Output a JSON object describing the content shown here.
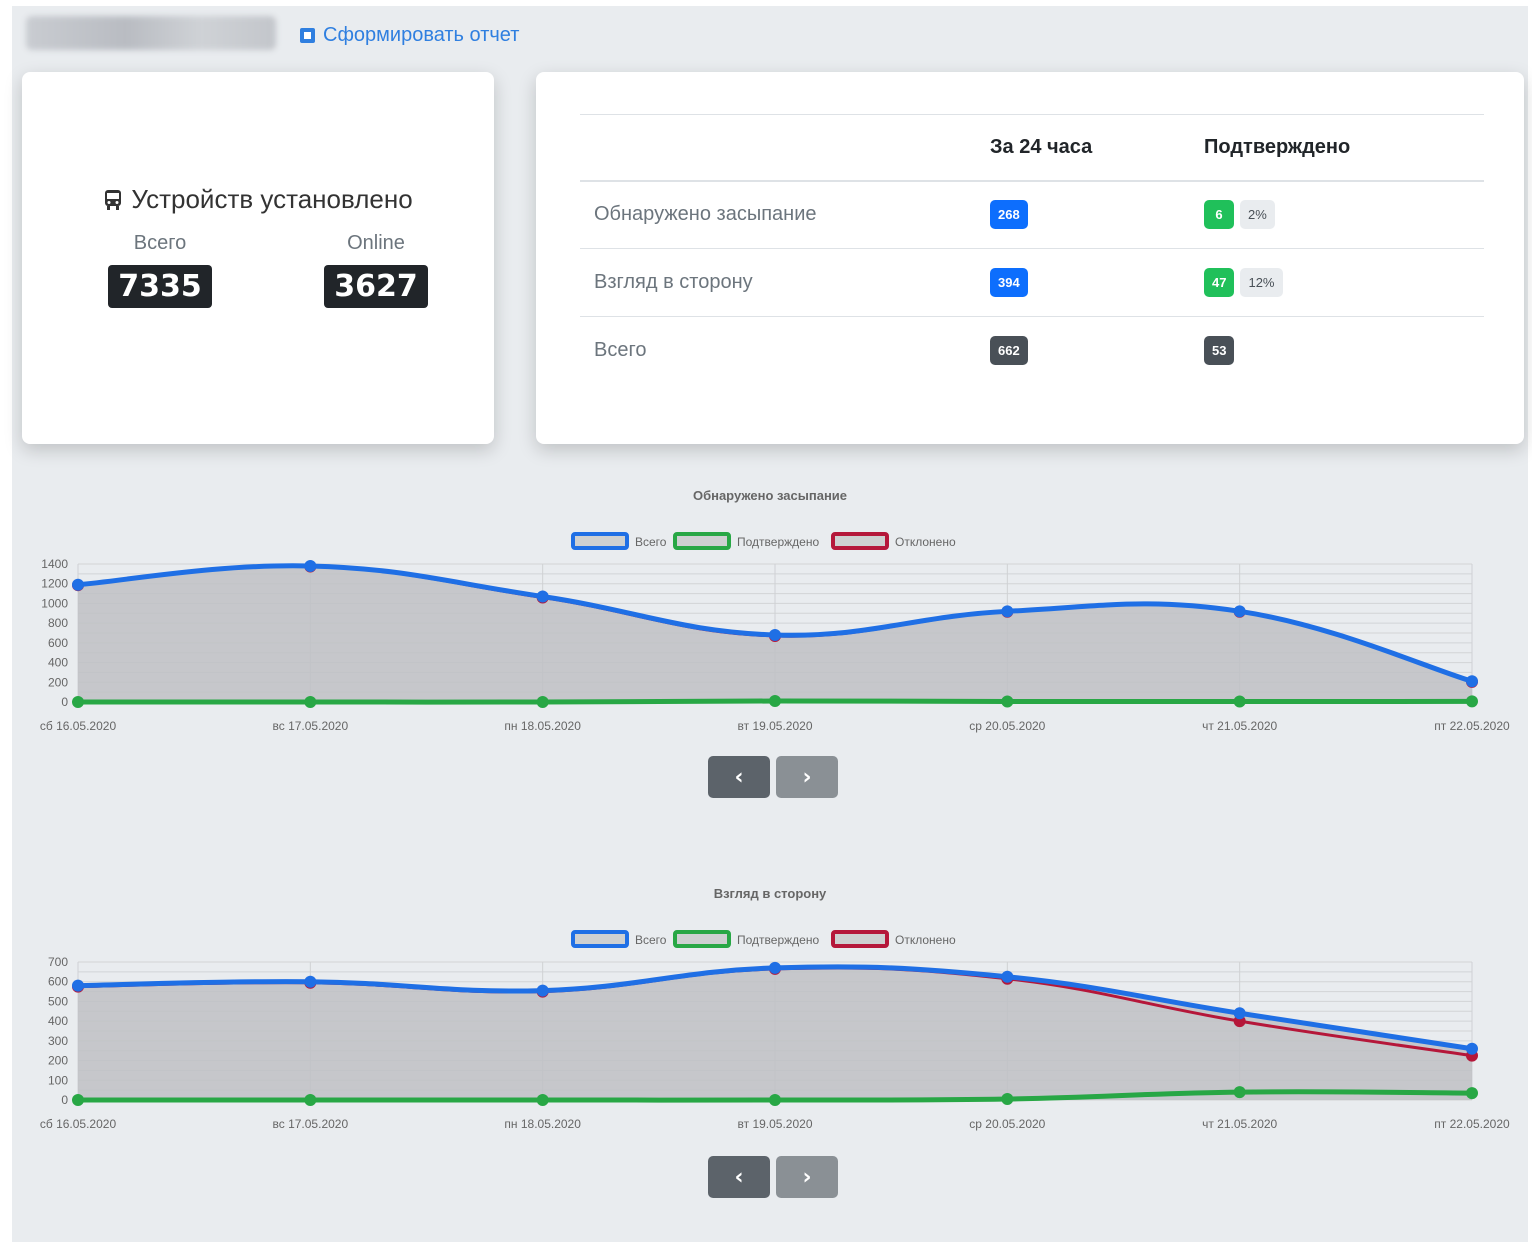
{
  "header": {
    "report_link": "Сформировать отчет"
  },
  "devices": {
    "title": "Устройств установлено",
    "total_label": "Всего",
    "total_value": "7335",
    "online_label": "Online",
    "online_value": "3627"
  },
  "stats": {
    "columns": [
      "",
      "За 24 часа",
      "Подтверждено"
    ],
    "rows": [
      {
        "label": "Обнаружено засыпание",
        "day": "268",
        "confirmed": "6",
        "pct": "2%"
      },
      {
        "label": "Взгляд в сторону",
        "day": "394",
        "confirmed": "47",
        "pct": "12%"
      },
      {
        "label": "Всего",
        "day": "662",
        "confirmed": "53",
        "pct": null
      }
    ]
  },
  "colors": {
    "total": "#1f6fe5",
    "confirmed": "#28a745",
    "rejected": "#b5173a",
    "fill": "#bfc1c4"
  },
  "nav": {
    "prev": "‹",
    "next": "›"
  },
  "chart_data": [
    {
      "type": "line",
      "title": "Обнаружено засыпание",
      "categories": [
        "сб 16.05.2020",
        "вс 17.05.2020",
        "пн 18.05.2020",
        "вт 19.05.2020",
        "ср 20.05.2020",
        "чт 21.05.2020",
        "пт 22.05.2020"
      ],
      "series": [
        {
          "name": "Всего",
          "values": [
            1190,
            1380,
            1070,
            680,
            920,
            920,
            210
          ]
        },
        {
          "name": "Подтверждено",
          "values": [
            0,
            0,
            0,
            10,
            5,
            5,
            6
          ]
        },
        {
          "name": "Отклонено",
          "values": [
            1185,
            1375,
            1060,
            670,
            915,
            915,
            204
          ]
        }
      ],
      "ylim": [
        0,
        1400
      ],
      "yticks": [
        0,
        200,
        400,
        600,
        800,
        1000,
        1200,
        1400
      ],
      "legend": "top",
      "grid": true
    },
    {
      "type": "line",
      "title": "Взгляд в сторону",
      "categories": [
        "сб 16.05.2020",
        "вс 17.05.2020",
        "пн 18.05.2020",
        "вт 19.05.2020",
        "ср 20.05.2020",
        "чт 21.05.2020",
        "пт 22.05.2020"
      ],
      "series": [
        {
          "name": "Всего",
          "values": [
            580,
            600,
            555,
            670,
            625,
            440,
            260
          ]
        },
        {
          "name": "Подтверждено",
          "values": [
            0,
            0,
            0,
            0,
            5,
            40,
            35
          ]
        },
        {
          "name": "Отклонено",
          "values": [
            575,
            595,
            550,
            665,
            615,
            400,
            225
          ]
        }
      ],
      "ylim": [
        0,
        700
      ],
      "yticks": [
        0,
        100,
        200,
        300,
        400,
        500,
        600,
        700
      ],
      "legend": "top",
      "grid": true
    }
  ]
}
